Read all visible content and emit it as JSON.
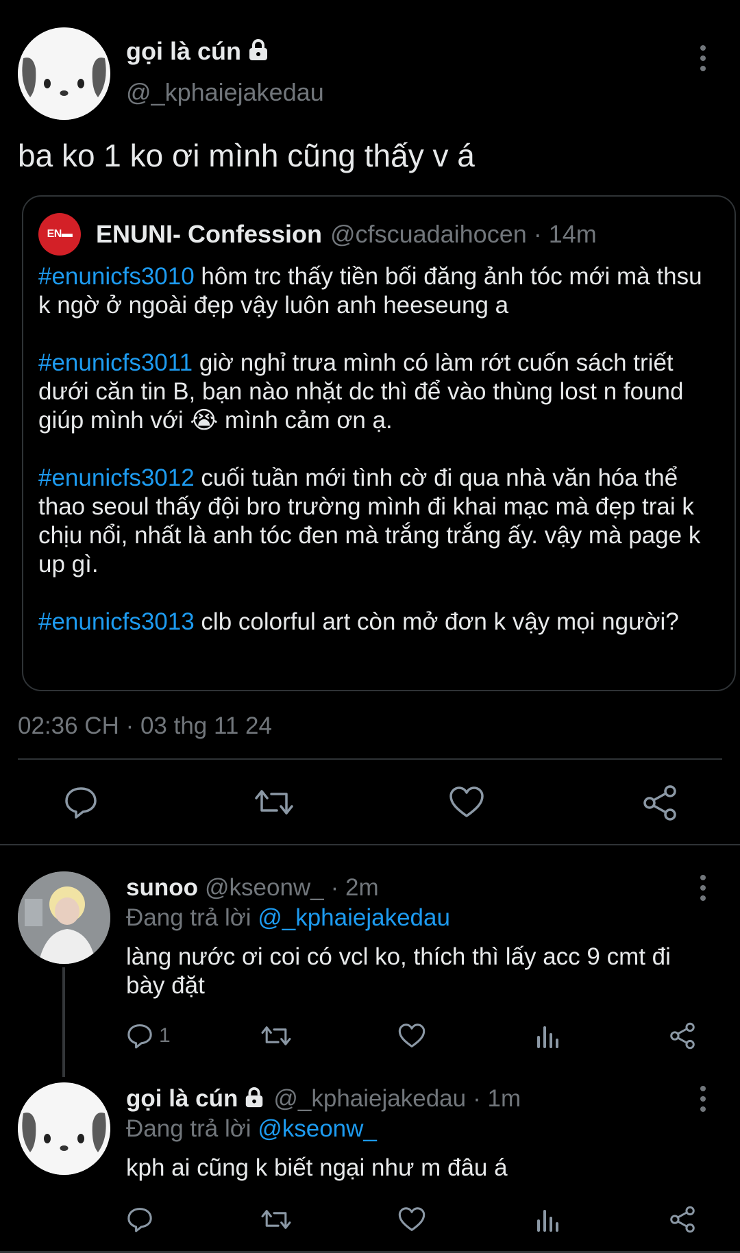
{
  "main_tweet": {
    "author_name": "gọi là cún",
    "author_handle": "@_kphaiejakedau",
    "text": "ba ko 1 ko ơi mình cũng thấy v á",
    "timestamp": "02:36 CH · 03 thg 11 24"
  },
  "quote": {
    "logo_text": "EN",
    "author_name": "ENUNI- Confession",
    "author_handle": "@cfscuadaihocen",
    "age": "· 14m",
    "posts": [
      {
        "tag": "#enunicfs3010",
        "text": " hôm trc thấy tiền bối đăng ảnh tóc mới mà thsu k ngờ ở ngoài đẹp vậy luôn anh heeseung a"
      },
      {
        "tag": "#enunicfs3011",
        "text": " giờ nghỉ trưa mình có làm rớt cuốn sách triết dưới căn tin B, bạn nào nhặt dc thì để vào thùng lost n found giúp mình với 😭 mình cảm ơn ạ."
      },
      {
        "tag": "#enunicfs3012",
        "text": " cuối tuần mới tình cờ đi qua nhà văn hóa thể thao seoul thấy đội bro trường mình đi khai mạc mà đẹp trai k chịu nổi, nhất là anh tóc đen mà trắng trắng ấy. vậy mà page k up gì."
      },
      {
        "tag": "#enunicfs3013",
        "text": " clb colorful art còn mở đơn k vậy mọi người?"
      }
    ]
  },
  "replies": [
    {
      "author_name": "sunoo",
      "author_handle": "@kseonw_",
      "age": "· 2m",
      "replying_prefix": "Đang trả lời ",
      "replying_to": "@_kphaiejakedau",
      "text": "làng nước ơi coi có vcl ko, thích thì lấy acc 9 cmt đi bày đặt",
      "reply_count": "1"
    },
    {
      "author_name": "gọi là cún",
      "author_handle": "@_kphaiejakedau",
      "age": "· 1m",
      "replying_prefix": "Đang trả lời ",
      "replying_to": "@kseonw_",
      "text": "kph ai cũng k biết ngại như m đâu á",
      "reply_count": ""
    }
  ],
  "colors": {
    "background": "#000000",
    "text": "#e7e9ea",
    "muted": "#71767b",
    "link": "#1d9bf0",
    "border": "#2f3336",
    "logo": "#d32027"
  },
  "icons": [
    "lock-icon",
    "more-icon",
    "reply-icon",
    "retweet-icon",
    "like-icon",
    "share-icon",
    "views-icon"
  ]
}
